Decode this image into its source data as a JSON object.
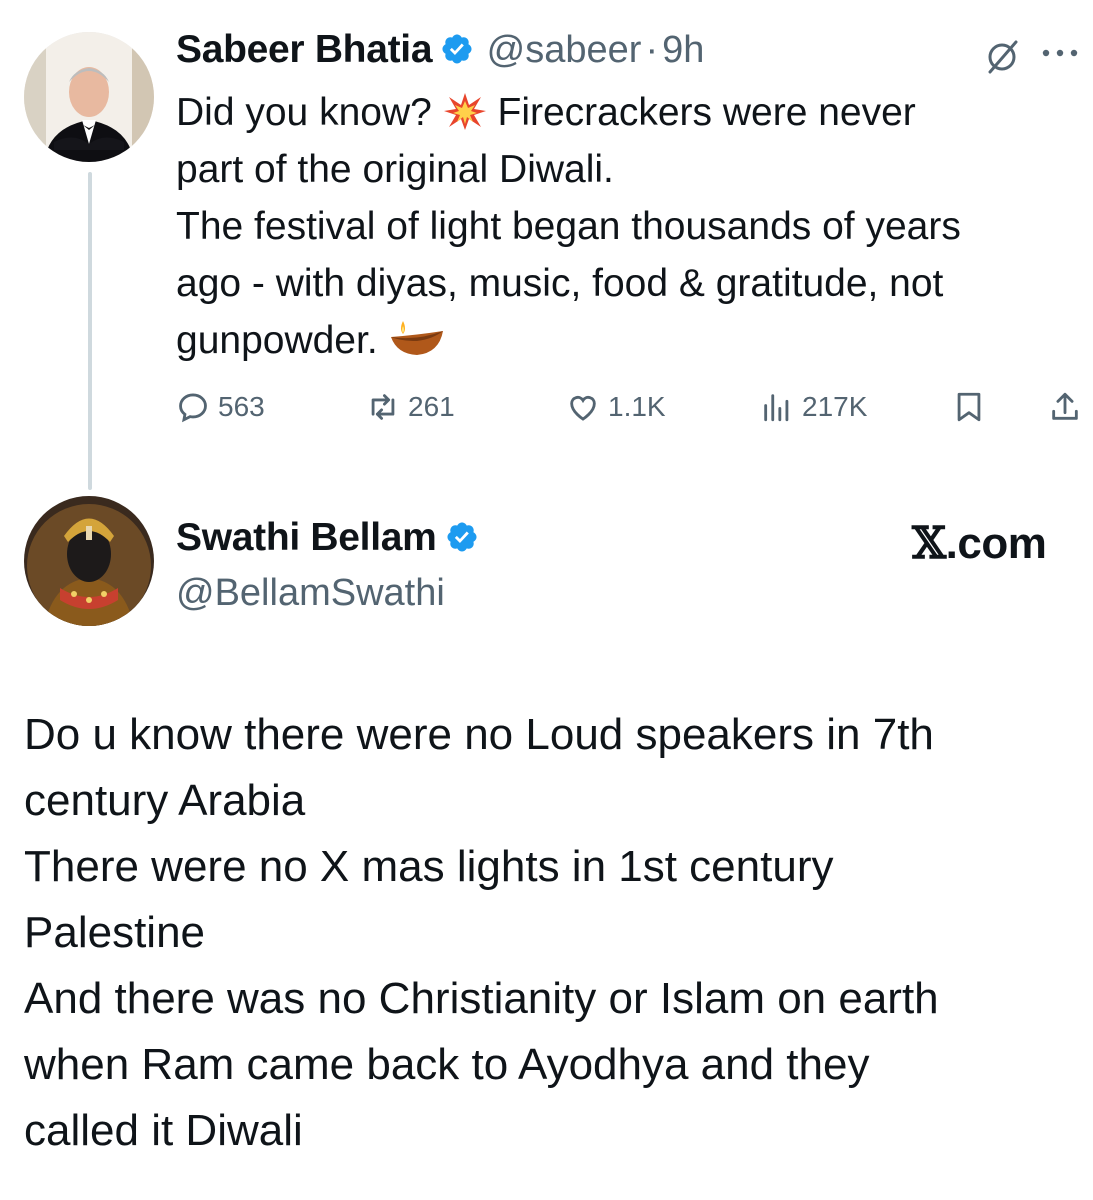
{
  "tweet1": {
    "author_name": "Sabeer Bhatia",
    "handle": "@sabeer",
    "separator": "·",
    "time": "9h",
    "lines": [
      "Did you know?",
      "Firecrackers were never",
      "part of the original Diwali.",
      "The festival of light began thousands of years",
      "ago - with diyas, music, food & gratitude, not",
      "gunpowder."
    ],
    "emoji_1": "collision-emoji",
    "emoji_2": "diya-lamp-emoji",
    "stats": {
      "replies": "563",
      "reposts": "261",
      "likes": "1.1K",
      "views": "217K"
    }
  },
  "tweet2": {
    "author_name": "Swathi Bellam",
    "handle": "@BellamSwathi",
    "brand_x": "𝕏",
    "brand_suffix": ".com",
    "lines": [
      "Do u know there were no Loud speakers in 7th",
      "century Arabia",
      "There were no X mas lights in 1st century",
      "Palestine",
      "And there was no Christianity or Islam on earth",
      "when Ram came back to Ayodhya and they",
      "called it Diwali"
    ]
  },
  "colors": {
    "verified_blue": "#1d9bf0",
    "secondary_text": "#536471",
    "thread_line": "#cfd9de"
  }
}
